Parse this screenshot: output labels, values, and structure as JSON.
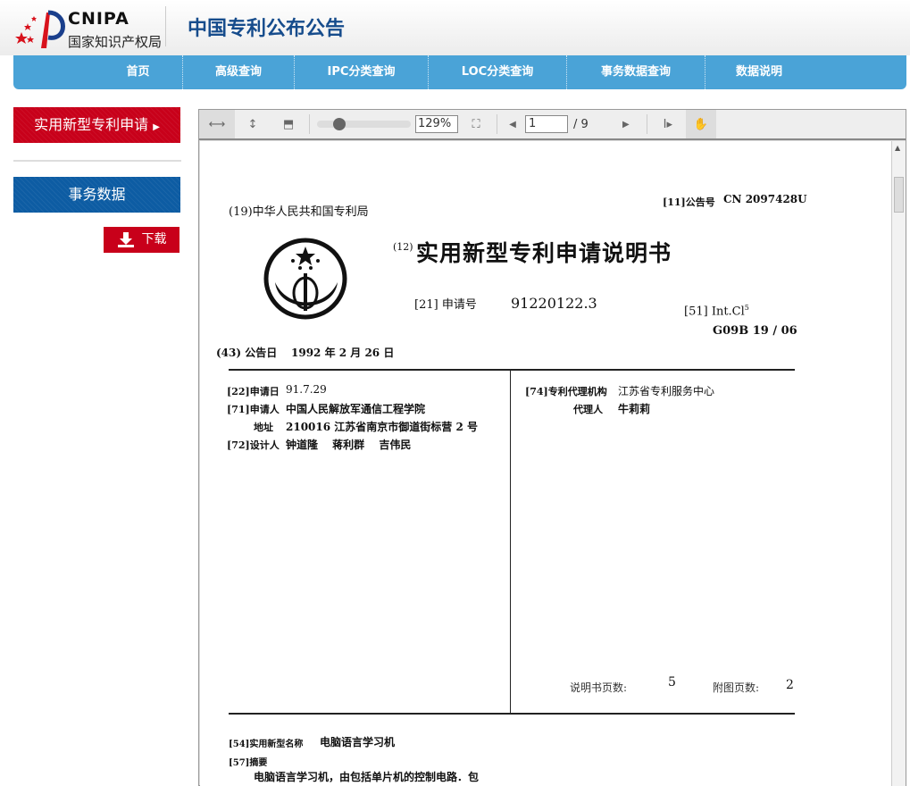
{
  "header": {
    "logo_text": "CNIPA",
    "logo_sub": "国家知识产权局",
    "site_title": "中国专利公布公告"
  },
  "nav": [
    {
      "label": "首页"
    },
    {
      "label": "高级查询"
    },
    {
      "label": "IPC分类查询"
    },
    {
      "label": "LOC分类查询"
    },
    {
      "label": "事务数据查询"
    },
    {
      "label": "数据说明"
    }
  ],
  "sidebar": {
    "utility_model": "实用新型专利申请",
    "affairs": "事务数据",
    "download": "下载"
  },
  "viewer": {
    "zoom": "129%",
    "page": "1",
    "total_pages": "/ 9",
    "zoom_fraction": 0.2
  },
  "doc": {
    "office": "(19)中华人民共和国专利局",
    "pub_no_label": "[11]公告号",
    "pub_no": "CN 2097428U",
    "doc_title_code": "(12)",
    "doc_title": "实用新型专利申请说明书",
    "app_no_label": "[21] 申请号",
    "app_no": "91220122.3",
    "intcl_label": "[51] Int.Cl",
    "intcl_sup": "5",
    "intcl": "G09B 19 / 06",
    "pub_date_label": "(43) 公告日",
    "pub_date": "1992 年 2 月 26 日",
    "filing_label": "[22]申请日",
    "filing_date": "91.7.29",
    "applicant_label": "[71]申请人",
    "applicant": "中国人民解放军通信工程学院",
    "address_label": "地址",
    "address": "210016 江苏省南京市御道街标营 2 号",
    "designer_label": "[72]设计人",
    "designers": "钟道隆　 蒋利群　 吉伟民",
    "agency_label": "[74]专利代理机构",
    "agency": "江苏省专利服务中心",
    "agent_label": "代理人",
    "agent": "牛莉莉",
    "desc_pages_label": "说明书页数:",
    "desc_pages": "5",
    "fig_pages_label": "附图页数:",
    "fig_pages": "2",
    "name_label": "[54]实用新型名称",
    "name": "电脑语言学习机",
    "abstract_label": "[57]摘要",
    "abstract": "电脑语言学习机，由包括单片机的控制电路．包"
  }
}
